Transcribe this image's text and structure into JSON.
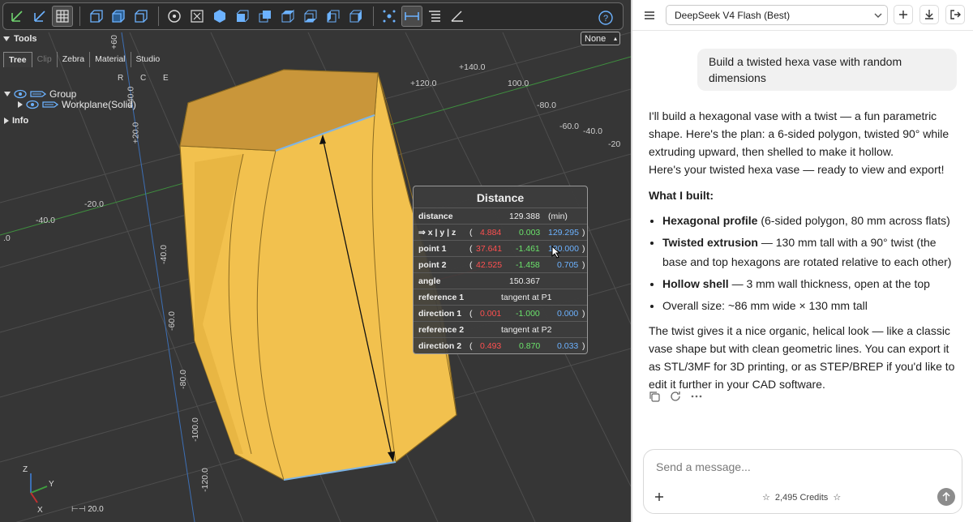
{
  "viewer": {
    "tools_label": "Tools",
    "tabs": [
      "Tree",
      "Clip",
      "Zebra",
      "Material",
      "Studio"
    ],
    "rce": "R C E",
    "tree": {
      "group": "Group",
      "workplane": "Workplane(Solid)",
      "info": "Info"
    },
    "view_select": "None",
    "scale_label": "20.0",
    "axis_labels": [
      "+140.0",
      "+120.0",
      "100.0",
      "-80.0",
      "-60.0",
      "-40.0",
      "-20",
      "+60",
      "+40.0",
      "+20.0",
      "-20.0",
      "-40.0",
      ".0",
      "-40.0",
      "-60.0",
      "-80.0",
      "-100.0",
      "-120.0"
    ],
    "triad": {
      "z": "Z",
      "y": "Y",
      "x": "X"
    },
    "distance_panel": {
      "title": "Distance",
      "distance": {
        "label": "distance",
        "value": "129.388",
        "note": "(min)"
      },
      "xyz": {
        "label": "⇒ x | y | z",
        "x": "4.884",
        "y": "0.003",
        "z": "129.295"
      },
      "point1": {
        "label": "point 1",
        "x": "37.641",
        "y": "-1.461",
        "z": "130.000"
      },
      "point2": {
        "label": "point 2",
        "x": "42.525",
        "y": "-1.458",
        "z": "0.705"
      },
      "angle": {
        "label": "angle",
        "value": "150.367"
      },
      "reference1": {
        "label": "reference 1",
        "value": "tangent at P1"
      },
      "direction1": {
        "label": "direction 1",
        "x": "0.001",
        "y": "-1.000",
        "z": "0.000"
      },
      "reference2": {
        "label": "reference 2",
        "value": "tangent at P2"
      },
      "direction2": {
        "label": "direction 2",
        "x": "0.493",
        "y": "0.870",
        "z": "0.033"
      }
    }
  },
  "chat": {
    "model": "DeepSeek V4 Flash (Best)",
    "user_message": "Build a twisted hexa vase with random dimensions",
    "reply": {
      "p1": "I'll build a hexagonal vase with a twist — a fun parametric shape. Here's the plan: a 6-sided polygon, twisted 90° while extruding upward, then shelled to make it hollow.",
      "p2": "Here's your twisted hexa vase — ready to view and export!",
      "heading": "What I built:",
      "bullets": [
        {
          "bold": "Hexagonal profile",
          "rest": " (6-sided polygon, 80 mm across flats)"
        },
        {
          "bold": "Twisted extrusion",
          "rest": " — 130 mm tall with a 90° twist (the base and top hexagons are rotated relative to each other)"
        },
        {
          "bold": "Hollow shell",
          "rest": " — 3 mm wall thickness, open at the top"
        },
        {
          "bold": "",
          "rest": "Overall size: ~86 mm wide × 130 mm tall"
        }
      ],
      "p3": "The twist gives it a nice organic, helical look — like a classic vase shape but with clean geometric lines. You can export it as STL/3MF for 3D printing, or as STEP/BREP if you'd like to edit it further in your CAD software."
    },
    "composer_placeholder": "Send a message...",
    "credits": "2,495 Credits"
  }
}
